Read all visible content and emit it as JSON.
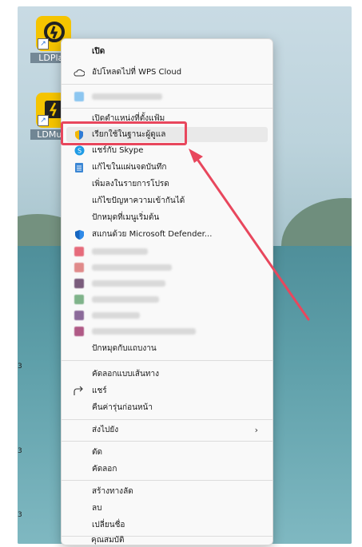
{
  "desktop": {
    "icons": [
      {
        "label": "LDPlay",
        "name": "ldplayer-icon"
      },
      {
        "label": "LDMulti",
        "name": "ldmulti-icon"
      }
    ]
  },
  "menu": {
    "open": "เปิด",
    "upload_wps": "อัปโหลดไปที่ WPS Cloud",
    "open_location": "เปิดตำแหน่งที่ตั้งแฟ้ม",
    "run_as_admin": "เรียกใช้ในฐานะผู้ดูแล",
    "share_skype": "แชร์กับ Skype",
    "pin_notebook": "แก้ไขในแผ่นจดบันทึก",
    "add_favorites": "เพิ่มลงในรายการโปรด",
    "troubleshoot": "แก้ไขปัญหาความเข้ากันได้",
    "pin_start": "ปักหมุดที่เมนูเริ่มต้น",
    "defender": "สแกนด้วย Microsoft Defender...",
    "pin_taskbar": "ปักหมุดกับแถบงาน",
    "copy_path": "คัดลอกแบบเส้นทาง",
    "share": "แชร์",
    "restore_prev": "คืนค่ารุ่นก่อนหน้า",
    "send_to": "ส่งไปยัง",
    "cut": "ตัด",
    "copy": "คัดลอก",
    "create_shortcut": "สร้างทางลัด",
    "delete": "ลบ",
    "rename": "เปลี่ยนชื่อ",
    "properties": "คุณสมบัติ"
  },
  "colors": {
    "highlight_box": "#e8475d",
    "arrow": "#e8475d"
  }
}
